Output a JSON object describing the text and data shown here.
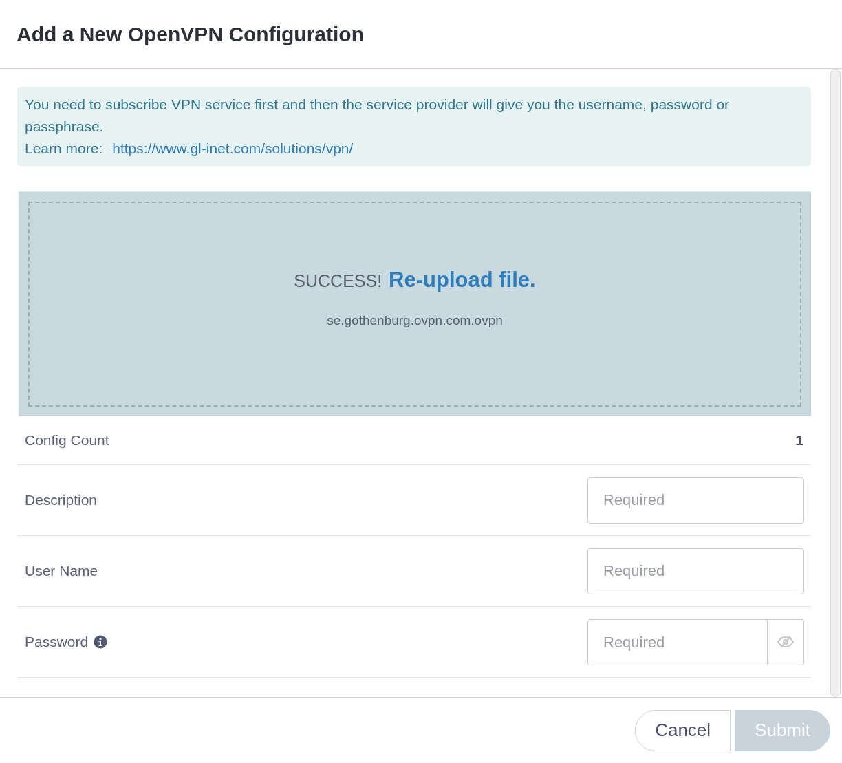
{
  "dialog": {
    "title": "Add a New OpenVPN Configuration"
  },
  "notice": {
    "text": "You need to subscribe VPN service first and then the service provider will give you the username, password or passphrase.",
    "learn_more_label": "Learn more:",
    "link": "https://www.gl-inet.com/solutions/vpn/"
  },
  "upload": {
    "status": "SUCCESS!",
    "action": "Re-upload file.",
    "filename": "se.gothenburg.ovpn.com.ovpn"
  },
  "config_count": {
    "label": "Config Count",
    "value": "1"
  },
  "fields": [
    {
      "kind": "text",
      "label": "Description",
      "placeholder": "Required"
    },
    {
      "kind": "text",
      "label": "User Name",
      "placeholder": "Required"
    },
    {
      "kind": "password",
      "label": "Password",
      "placeholder": "Required"
    }
  ],
  "buttons": [
    {
      "label": "Cancel",
      "kind": "secondary",
      "disabled": false
    },
    {
      "label": "Submit",
      "kind": "primary",
      "disabled": true
    }
  ]
}
